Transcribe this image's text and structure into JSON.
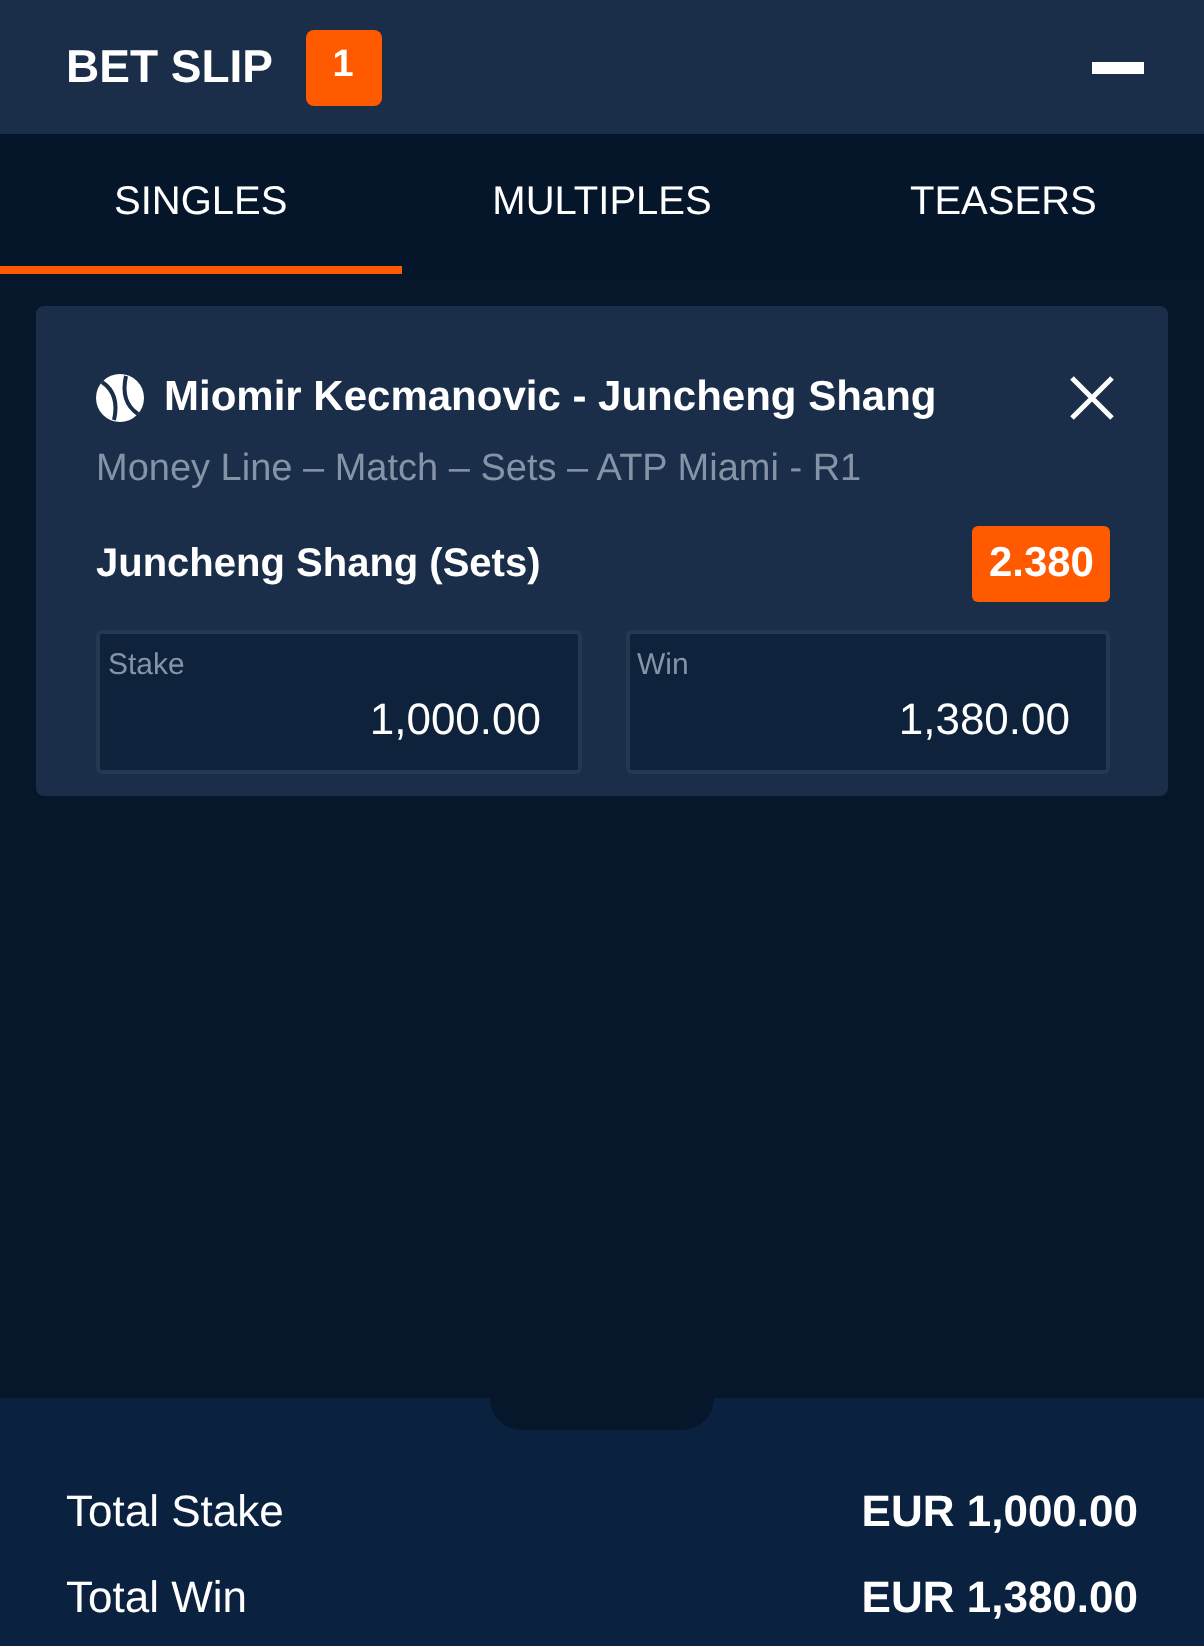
{
  "header": {
    "title": "BET SLIP",
    "count": "1"
  },
  "tabs": [
    {
      "label": "SINGLES",
      "selected": true
    },
    {
      "label": "MULTIPLES",
      "selected": false
    },
    {
      "label": "TEASERS",
      "selected": false
    }
  ],
  "bets": [
    {
      "event": "Miomir Kecmanovic - Juncheng Shang",
      "market": "Money Line – Match – Sets – ATP Miami - R1",
      "selection": "Juncheng Shang (Sets)",
      "odds": "2.380",
      "fields": [
        {
          "label": "Stake",
          "value": "1,000.00"
        },
        {
          "label": "Win",
          "value": "1,380.00"
        }
      ]
    }
  ],
  "totals": [
    {
      "label": "Total Stake",
      "value": "EUR 1,000.00"
    },
    {
      "label": "Total Win",
      "value": "EUR 1,380.00"
    }
  ]
}
